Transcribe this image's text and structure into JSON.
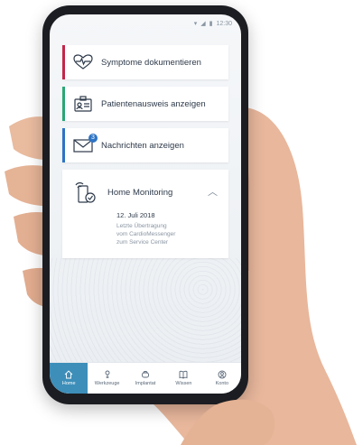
{
  "status": {
    "time": "12:30"
  },
  "cards": [
    {
      "label": "Symptome dokumentieren",
      "accent": "#c3274a",
      "icon": "heart-pulse-icon"
    },
    {
      "label": "Patientenausweis anzeigen",
      "accent": "#2aa775",
      "icon": "id-card-icon"
    },
    {
      "label": "Nachrichten anzeigen",
      "accent": "#2e74c4",
      "icon": "envelope-icon",
      "badge": "3"
    }
  ],
  "monitoring": {
    "title": "Home Monitoring",
    "date": "12. Juli 2018",
    "lines": [
      "Letzte Übertragung",
      "vom CardioMessenger",
      "zum Service Center"
    ]
  },
  "nav": [
    {
      "label": "Home",
      "icon": "home-icon",
      "active": true
    },
    {
      "label": "Werkzeuge",
      "icon": "tools-icon"
    },
    {
      "label": "Implantat",
      "icon": "implant-icon"
    },
    {
      "label": "Wissen",
      "icon": "book-icon"
    },
    {
      "label": "Konto",
      "icon": "account-icon"
    }
  ],
  "colors": {
    "nav_active": "#3d8eb9",
    "skin": "#e8b79c"
  }
}
